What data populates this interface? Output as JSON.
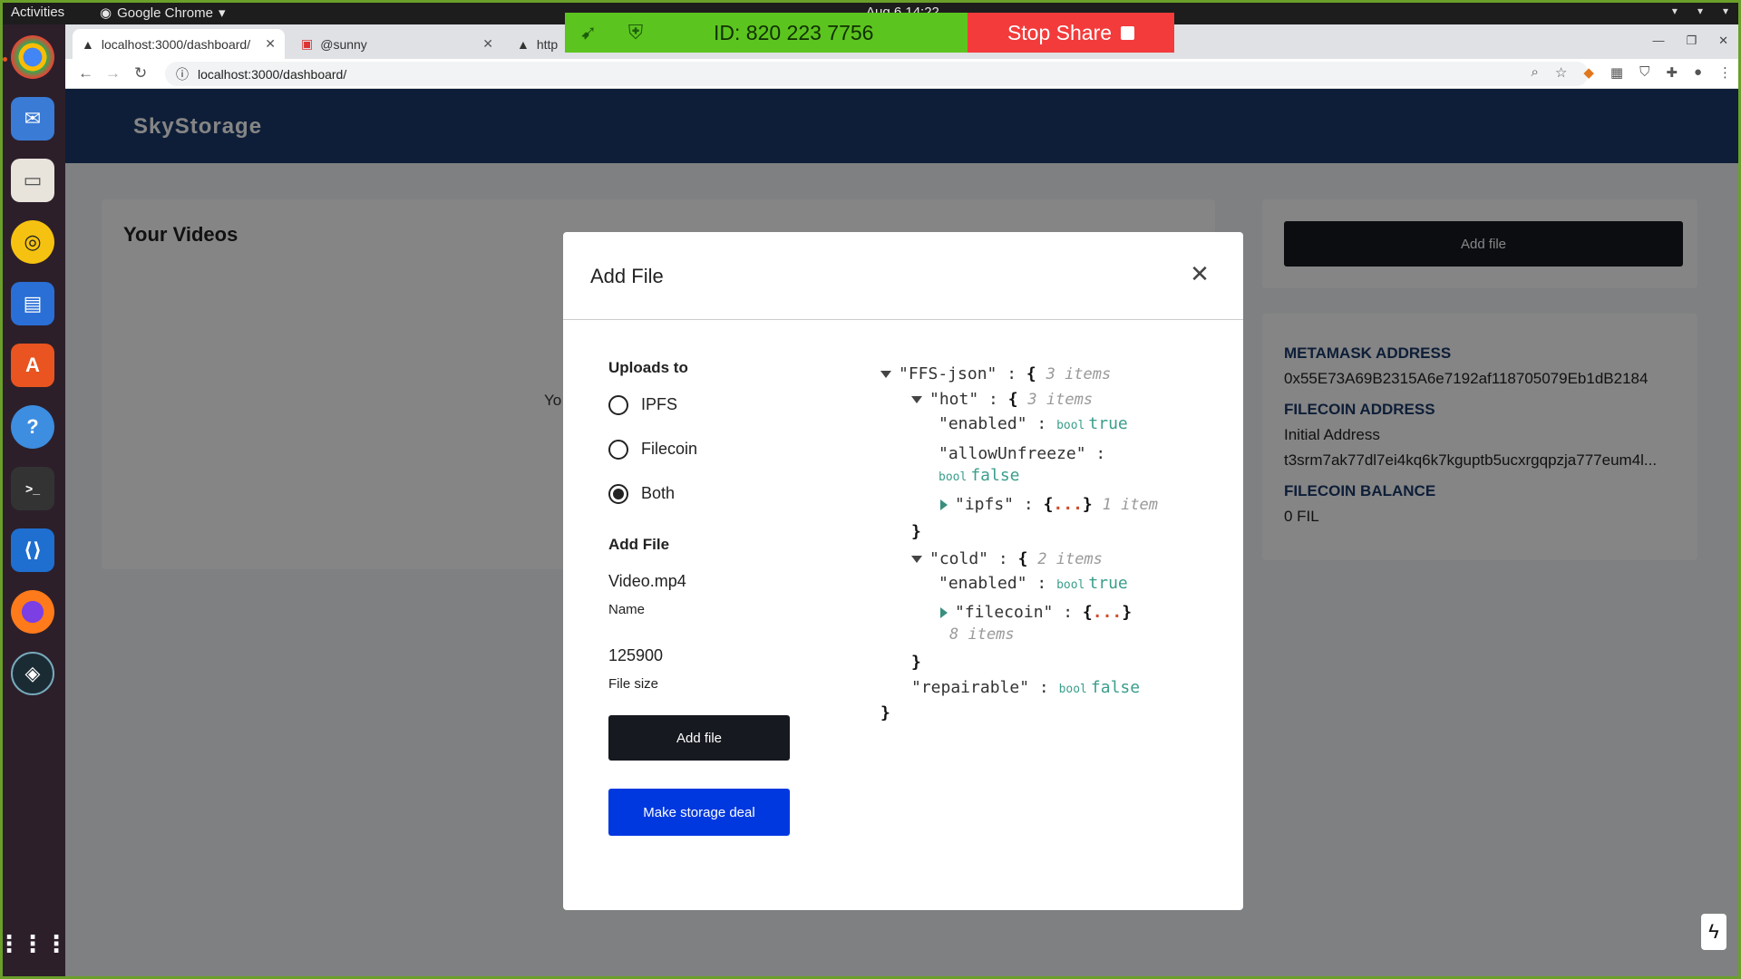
{
  "os": {
    "activities": "Activities",
    "app_name": "Google Chrome",
    "clock": "Aug 6 14:22"
  },
  "browser": {
    "tabs": [
      {
        "label": "localhost:3000/dashboard/"
      },
      {
        "label": "@sunny"
      },
      {
        "label": "http"
      }
    ],
    "url": "localhost:3000/dashboard/"
  },
  "share_banner": {
    "id_text": "ID: 820 223 7756",
    "stop_label": "Stop Share"
  },
  "app": {
    "brand": "SkyStorage",
    "videos_title": "Your Videos",
    "videos_empty": "Yo",
    "add_file_button": "Add file",
    "info": [
      {
        "label": "METAMASK ADDRESS",
        "value": "0x55E73A69B2315A6e7192af118705079Eb1dB2184"
      },
      {
        "label": "FILECOIN ADDRESS",
        "value": "Initial Address",
        "value2": "t3srm7ak77dl7ei4kq6k7kguptb5ucxrgqpzja777eum4l..."
      },
      {
        "label": "FILECOIN BALANCE",
        "value": "0 FIL"
      }
    ]
  },
  "modal": {
    "title": "Add File",
    "uploads_to_label": "Uploads to",
    "options": [
      {
        "label": "IPFS",
        "selected": false
      },
      {
        "label": "Filecoin",
        "selected": false
      },
      {
        "label": "Both",
        "selected": true
      }
    ],
    "add_file_section": "Add File",
    "file_name_value": "Video.mp4",
    "file_name_label": "Name",
    "file_size_value": "125900",
    "file_size_label": "File size",
    "add_file_button": "Add file",
    "deal_button": "Make storage deal"
  },
  "json_viewer": {
    "root_key": "\"FFS-json\"",
    "root_count": "3 items",
    "hot_key": "\"hot\"",
    "hot_count": "3 items",
    "hot_enabled_key": "\"enabled\"",
    "hot_enabled_val": "true",
    "allow_key": "\"allowUnfreeze\"",
    "allow_val": "false",
    "ipfs_key": "\"ipfs\"",
    "ipfs_count": "1 item",
    "cold_key": "\"cold\"",
    "cold_count": "2 items",
    "cold_enabled_key": "\"enabled\"",
    "cold_enabled_val": "true",
    "filecoin_key": "\"filecoin\"",
    "filecoin_count": "8 items",
    "repairable_key": "\"repairable\"",
    "repairable_val": "false",
    "type_bool": "bool",
    "ellipsis": "...",
    "colon": ":",
    "open_brace": "{",
    "close_brace": "}"
  }
}
